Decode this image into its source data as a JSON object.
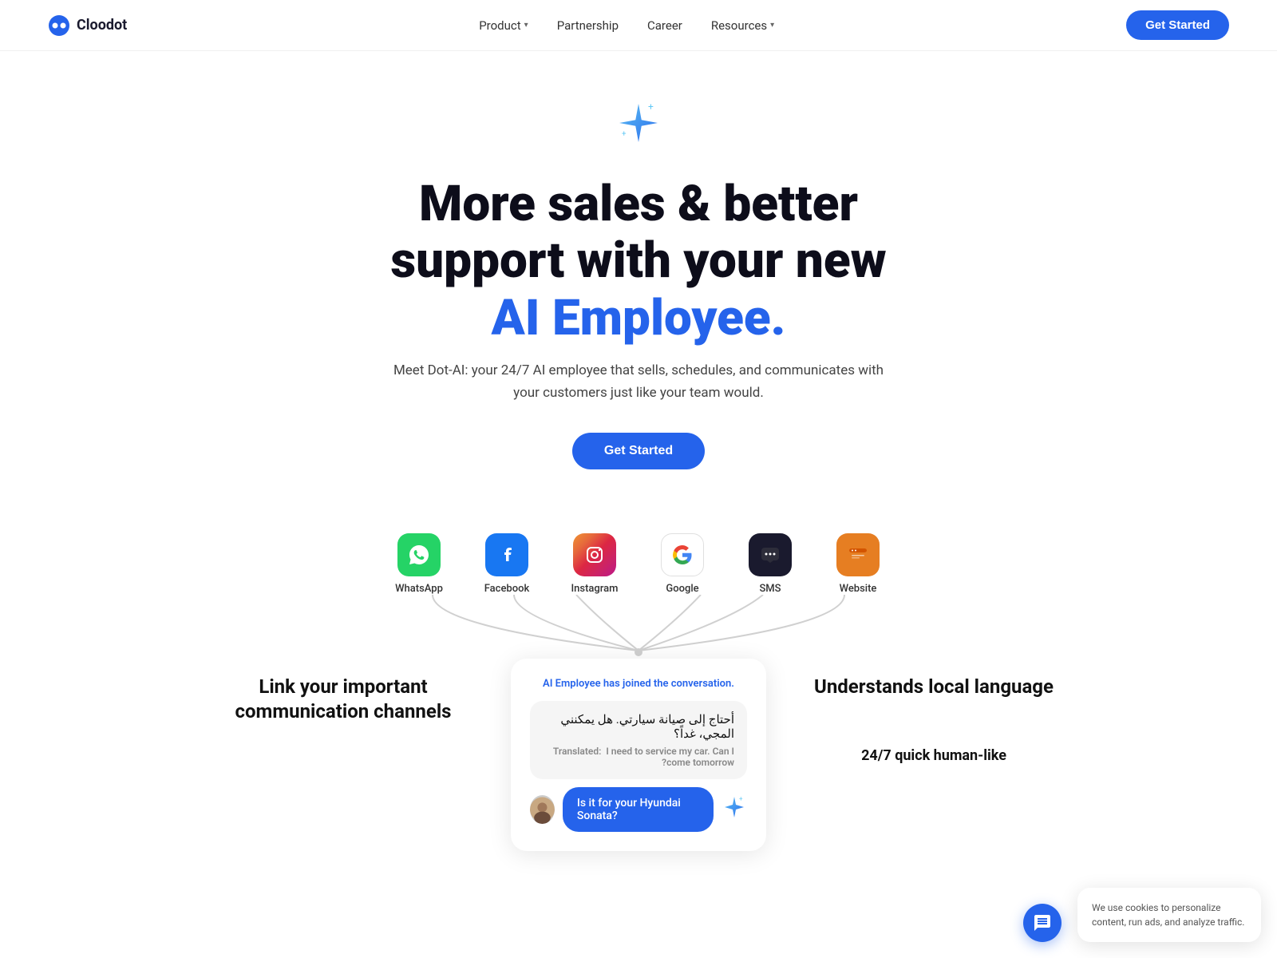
{
  "brand": {
    "name": "Cloodot"
  },
  "nav": {
    "product_label": "Product",
    "partnership_label": "Partnership",
    "career_label": "Career",
    "resources_label": "Resources",
    "cta_label": "Get Started"
  },
  "hero": {
    "line1": "More sales & better",
    "line2": "support  with your new",
    "highlight": "AI Employee.",
    "subtitle": "Meet Dot-AI: your 24/7 AI employee that sells, schedules, and communicates with your customers just like your team would.",
    "cta_label": "Get Started"
  },
  "channels": [
    {
      "id": "whatsapp",
      "label": "WhatsApp",
      "icon": "💬",
      "class": "icon-whatsapp"
    },
    {
      "id": "facebook",
      "label": "Facebook",
      "icon": "f",
      "class": "icon-facebook"
    },
    {
      "id": "instagram",
      "label": "Instagram",
      "icon": "📷",
      "class": "icon-instagram"
    },
    {
      "id": "google",
      "label": "Google",
      "icon": "G",
      "class": "icon-google"
    },
    {
      "id": "sms",
      "label": "SMS",
      "icon": "💬",
      "class": "icon-sms"
    },
    {
      "id": "website",
      "label": "Website",
      "icon": "🌐",
      "class": "icon-website"
    }
  ],
  "lower": {
    "left_title": "Link your important communication channels",
    "right_title": "Understands local language",
    "right_subtitle": "24/7 quick human-like"
  },
  "chat_card": {
    "header_prefix": "AI Employee",
    "header_suffix": "has joined the conversation.",
    "arabic_message": "أحتاج إلى صيانة سيارتي. هل يمكنني المجي، غداً؟",
    "translated_label": "Translated:",
    "translated_text": "I need to service my car. Can I come tomorrow?",
    "response": "Is it for your Hyundai Sonata?"
  },
  "cookie": {
    "text": "We use cookies to personalize content, run ads, and analyze traffic."
  }
}
